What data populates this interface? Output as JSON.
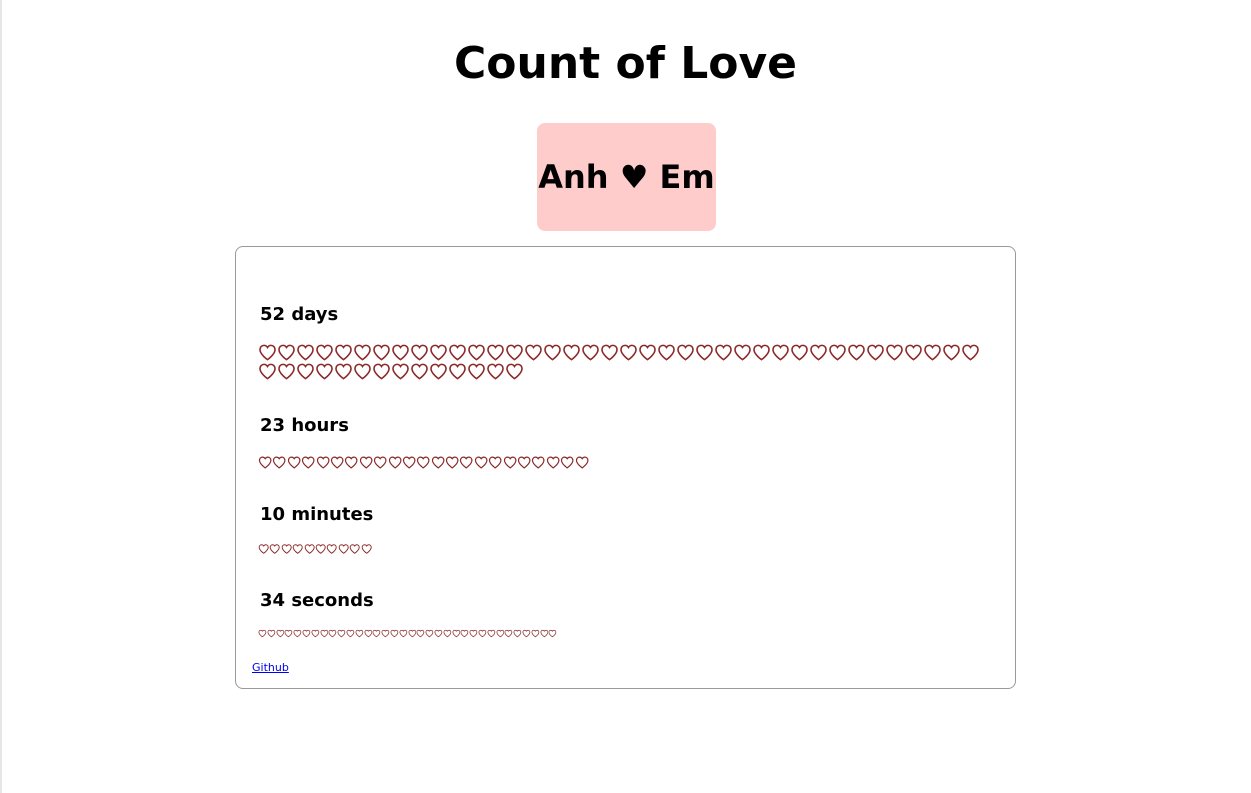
{
  "page": {
    "title": "Count of Love",
    "couple": "Anh ♥ Em"
  },
  "counter": {
    "units": [
      {
        "id": "days",
        "label": "52 days",
        "count": 52
      },
      {
        "id": "hours",
        "label": "23 hours",
        "count": 23
      },
      {
        "id": "minutes",
        "label": "10 minutes",
        "count": 10
      },
      {
        "id": "seconds",
        "label": "34 seconds",
        "count": 34
      }
    ],
    "heart_icon": "heart-outline-icon",
    "heart_color": "#8b2a2a"
  },
  "footer": {
    "github_label": "Github"
  }
}
